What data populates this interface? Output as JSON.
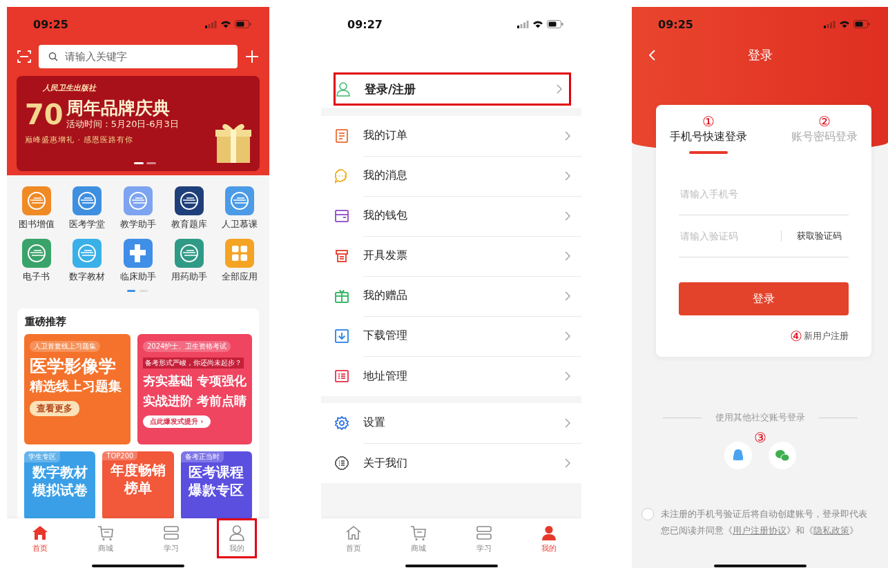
{
  "home": {
    "status_time": "09:25",
    "search": {
      "placeholder": "请输入关键字"
    },
    "banner": {
      "publisher": "人民卫生出版社",
      "anniversary": "70",
      "headline": "周年品牌庆典",
      "dates": "活动时间：5月20日-6月3日",
      "slogan": "巅峰盛惠增礼 · 感恩医路有你"
    },
    "apps": [
      {
        "label": "图书增值",
        "color": "#f08a24",
        "kind": "logo"
      },
      {
        "label": "医考学堂",
        "color": "#3f8fe0",
        "kind": "logo"
      },
      {
        "label": "教学助手",
        "color": "#7da4f0",
        "kind": "logo"
      },
      {
        "label": "教育题库",
        "color": "#1f3f7a",
        "kind": "logo"
      },
      {
        "label": "人卫慕课",
        "color": "#4b9be6",
        "kind": "logo"
      },
      {
        "label": "电子书",
        "color": "#3aa36a",
        "kind": "logo"
      },
      {
        "label": "数字教材",
        "color": "#3ab0e8",
        "kind": "logo"
      },
      {
        "label": "临床助手",
        "color": "#3f8ee8",
        "kind": "cross"
      },
      {
        "label": "用药助手",
        "color": "#2f9a86",
        "kind": "logo"
      },
      {
        "label": "全部应用",
        "color": "#f5a323",
        "kind": "grid"
      }
    ],
    "recommend": {
      "title": "重磅推荐",
      "featured": [
        {
          "tag": "人卫首套线上习题集",
          "lines": [
            "医学影像学",
            "精选线上习题集"
          ],
          "button": "查看更多",
          "color": "#f4722b"
        },
        {
          "tag": "2024护士、卫生资格考试",
          "note": "备考形式严峻，你还尚未起步？",
          "lines": [
            "夯实基础 专项强化",
            "实战进阶 考前点睛"
          ],
          "button": "点此爆发式提升 ›",
          "color": "#ef4560"
        }
      ],
      "more": [
        {
          "tag": "学生专区",
          "lines": [
            "数字教材",
            "模拟试卷"
          ],
          "color": "#3a9fe6"
        },
        {
          "tag": "TOP200",
          "lines": [
            "年度畅销",
            "榜单"
          ],
          "color": "#f2583a"
        },
        {
          "tag": "备考正当时",
          "lines": [
            "医考课程",
            "爆款专区"
          ],
          "color": "#5b4fe0"
        }
      ]
    },
    "tab_bar": [
      {
        "label": "首页",
        "selected": true,
        "highlighted": false
      },
      {
        "label": "商城",
        "selected": false,
        "highlighted": false
      },
      {
        "label": "学习",
        "selected": false,
        "highlighted": false
      },
      {
        "label": "我的",
        "selected": false,
        "highlighted": true
      }
    ]
  },
  "profile": {
    "status_time": "09:27",
    "login": {
      "label": "登录/注册",
      "highlighted": true
    },
    "menu_groups": [
      [
        {
          "label": "我的订单",
          "color": "#ef7a45"
        },
        {
          "label": "我的消息",
          "color": "#f3b431"
        },
        {
          "label": "我的钱包",
          "color": "#9b59d0"
        },
        {
          "label": "开具发票",
          "color": "#e84a3a"
        },
        {
          "label": "我的赠品",
          "color": "#3cb96a"
        },
        {
          "label": "下载管理",
          "color": "#3d8ee8"
        },
        {
          "label": "地址管理",
          "color": "#e8465a"
        }
      ],
      [
        {
          "label": "设置",
          "color": "#3d7ee8"
        },
        {
          "label": "关于我们",
          "color": "#666666"
        }
      ]
    ],
    "tab_bar": [
      {
        "label": "首页",
        "selected": false,
        "highlighted": false
      },
      {
        "label": "商城",
        "selected": false,
        "highlighted": false
      },
      {
        "label": "学习",
        "selected": false,
        "highlighted": false
      },
      {
        "label": "我的",
        "selected": true,
        "highlighted": false
      }
    ]
  },
  "login": {
    "status_time": "09:25",
    "title": "登录",
    "tabs": [
      {
        "label": "手机号快速登录",
        "annotation": "①",
        "selected": true
      },
      {
        "label": "账号密码登录",
        "annotation": "②",
        "selected": false
      }
    ],
    "phone_field": {
      "placeholder": "请输入手机号"
    },
    "code_field": {
      "placeholder": "请输入验证码"
    },
    "get_code": "获取验证码",
    "login_button": "登录",
    "register": {
      "annotation": "④",
      "label": "新用户注册"
    },
    "social": {
      "label": "使用其他社交账号登录",
      "annotation": "③"
    },
    "agreement": {
      "checked": false,
      "segments": [
        {
          "kind": "text",
          "text": "未注册的手机号验证后将自动创建账号，登录即代表您已阅读并同意《"
        },
        {
          "kind": "link",
          "text": "用户注册协议"
        },
        {
          "kind": "text",
          "text": "》和《"
        },
        {
          "kind": "link",
          "text": "隐私政策"
        },
        {
          "kind": "text",
          "text": "》"
        }
      ]
    }
  }
}
